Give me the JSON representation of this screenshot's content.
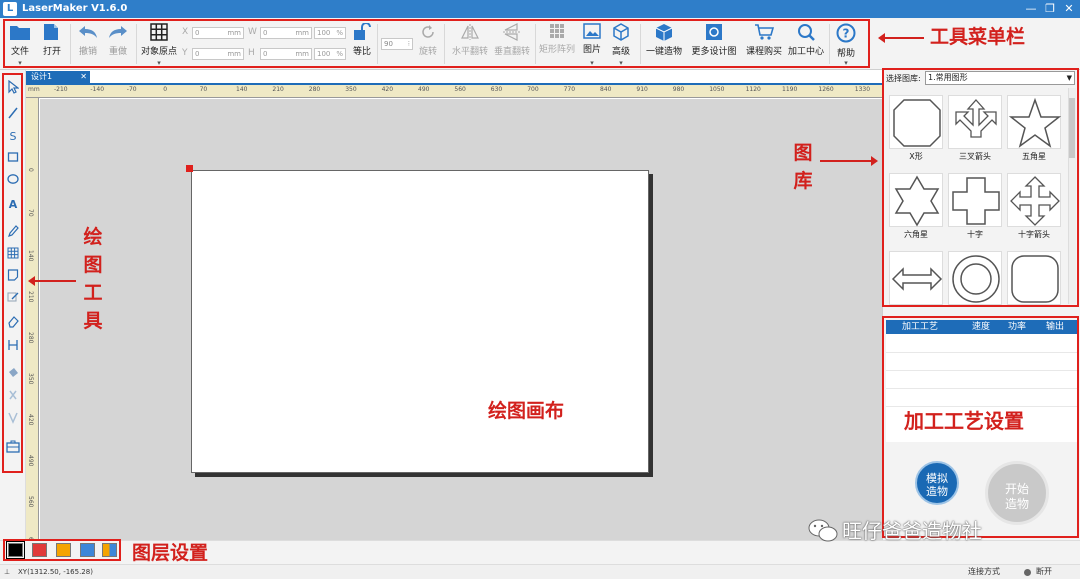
{
  "window": {
    "title": "LaserMaker V1.6.0",
    "logo_text": "L",
    "minimize": "—",
    "restore": "❐",
    "close": "✕"
  },
  "toolbar": {
    "file": "文件",
    "open": "打开",
    "undo": "撤销",
    "redo": "重做",
    "origin": "对象原点",
    "x_label": "X",
    "y_label": "Y",
    "w_label": "W",
    "h_label": "H",
    "x_value": "0",
    "y_value": "0",
    "w_value": "0",
    "h_value": "0",
    "unit": "mm",
    "w_pct": "100",
    "h_pct": "100",
    "pct_unit": "%",
    "lock": "等比",
    "rotate_value": "90",
    "rotate": "旋转",
    "flip_h": "水平翻转",
    "flip_v": "垂直翻转",
    "array": "矩形阵列",
    "image": "图片",
    "advanced": "高级",
    "one_click": "一键造物",
    "more_designs": "更多设计图",
    "buy_course": "课程购买",
    "processing_center": "加工中心",
    "help": "帮助"
  },
  "document_tab": {
    "label": "设计1",
    "close": "✕"
  },
  "ruler": {
    "unit": "mm",
    "top_ticks": [
      "-210",
      "-140",
      "-70",
      "0",
      "70",
      "140",
      "210",
      "280",
      "350",
      "420",
      "490",
      "560",
      "630",
      "700",
      "770",
      "840",
      "910",
      "980",
      "1050",
      "1120",
      "1190",
      "1260",
      "1330"
    ],
    "left_ticks": [
      "0",
      "70",
      "140",
      "210",
      "280",
      "350",
      "420",
      "490",
      "560",
      "630"
    ]
  },
  "library": {
    "select_label": "选择图库:",
    "selected": "1.常用图形",
    "items": [
      {
        "label": "X形",
        "icon": "x-shape-icon"
      },
      {
        "label": "三叉箭头",
        "icon": "trident-arrow-icon"
      },
      {
        "label": "五角星",
        "icon": "five-point-star-icon"
      },
      {
        "label": "六角星",
        "icon": "six-point-star-icon"
      },
      {
        "label": "十字",
        "icon": "cross-icon"
      },
      {
        "label": "十字箭头",
        "icon": "cross-arrow-icon"
      },
      {
        "label": "",
        "icon": "double-arrow-icon"
      },
      {
        "label": "",
        "icon": "ring-icon"
      },
      {
        "label": "",
        "icon": "rounded-square-icon"
      }
    ]
  },
  "process": {
    "columns": [
      "加工工艺",
      "速度",
      "功率",
      "输出"
    ],
    "simulate": [
      "模拟",
      "造物"
    ],
    "start": [
      "开始",
      "造物"
    ]
  },
  "layers": {
    "colors": [
      "#000000",
      "#e03a3a",
      "#f5a300",
      "#3d86d8"
    ],
    "multi_icon": "multicolor-layer-icon"
  },
  "status": {
    "coords": "XY(1312.50, -165.28)",
    "connect": "连接方式",
    "state": "断开"
  },
  "annotations": {
    "toolbar": "工具菜单栏",
    "library": [
      "图",
      "库"
    ],
    "drawing_tools": [
      "绘",
      "图",
      "工",
      "具"
    ],
    "canvas": "绘图画布",
    "process": "加工工艺设置",
    "layers": "图层设置"
  },
  "watermark": "旺仔爸爸造物社",
  "colors": {
    "accent": "#1e6cb8",
    "title_bar": "#2f7ec9",
    "annotation": "#d2211d",
    "handle": "#e0201c"
  }
}
